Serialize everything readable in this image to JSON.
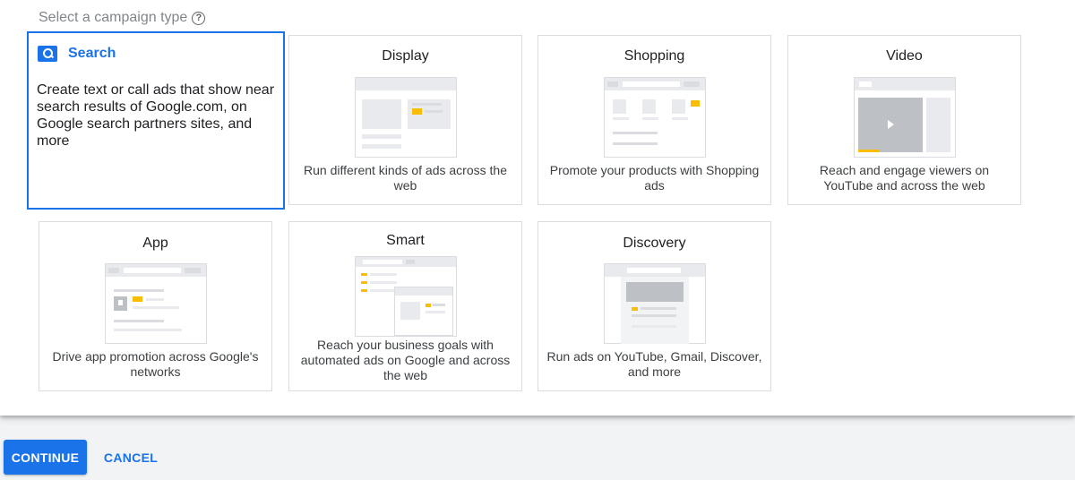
{
  "header": {
    "title": "Select a campaign type",
    "help_icon": "question-circle-icon"
  },
  "cards": {
    "search": {
      "title": "Search",
      "description": "Create text or call ads that show near search results of Google.com, on Google search partners sites, and more",
      "icon": "search-icon",
      "selected": true
    },
    "display": {
      "title": "Display",
      "description": "Run different kinds of ads across the web"
    },
    "shopping": {
      "title": "Shopping",
      "description": "Promote your products with Shopping ads"
    },
    "video": {
      "title": "Video",
      "description": "Reach and engage viewers on YouTube and across the web"
    },
    "app": {
      "title": "App",
      "description": "Drive app promotion across Google's networks"
    },
    "smart": {
      "title": "Smart",
      "description": "Reach your business goals with automated ads on Google and across the web"
    },
    "discovery": {
      "title": "Discovery",
      "description": "Run ads on YouTube, Gmail, Discover, and more"
    }
  },
  "footer": {
    "continue_label": "CONTINUE",
    "cancel_label": "CANCEL"
  },
  "colors": {
    "accent": "#1a73e8",
    "highlight": "#fbbc04",
    "border": "#dadce0",
    "footer_bg": "#f1f3f4"
  }
}
